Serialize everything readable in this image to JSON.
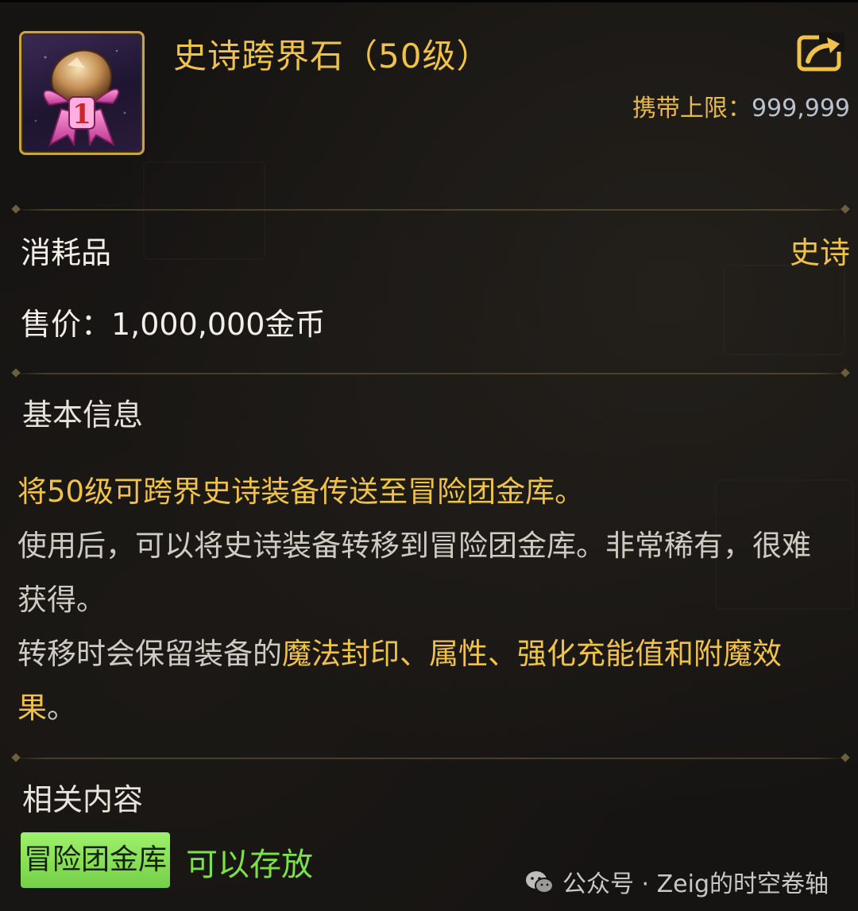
{
  "item": {
    "title": "史诗跨界石（50级）",
    "icon": "epic-cross-stone-icon",
    "carry_limit_label": "携带上限：",
    "carry_limit_value": "999,999",
    "type": "消耗品",
    "rarity": "史诗",
    "sell_price": "售价：1,000,000金币"
  },
  "basic_info": {
    "heading": "基本信息",
    "summary": "将50级可跨界史诗装备传送至冒险团金库。",
    "usage": "使用后，可以将史诗装备转移到冒险团金库。非常稀有，很难获得。",
    "retain_prefix": "转移时会保留装备的",
    "retain_highlight": "魔法封印、属性、强化充能值和附魔效果",
    "retain_suffix": "。"
  },
  "related": {
    "heading": "相关内容",
    "storage_tag": "冒险团金库",
    "storage_status": "可以存放"
  },
  "watermark": {
    "text": "公众号 · Zeig的时空卷轴",
    "icon": "wechat-icon"
  },
  "colors": {
    "gold": "#f0c24a",
    "green_tag": "#8ee85a",
    "green_text": "#7de04a",
    "background": "#161412"
  }
}
